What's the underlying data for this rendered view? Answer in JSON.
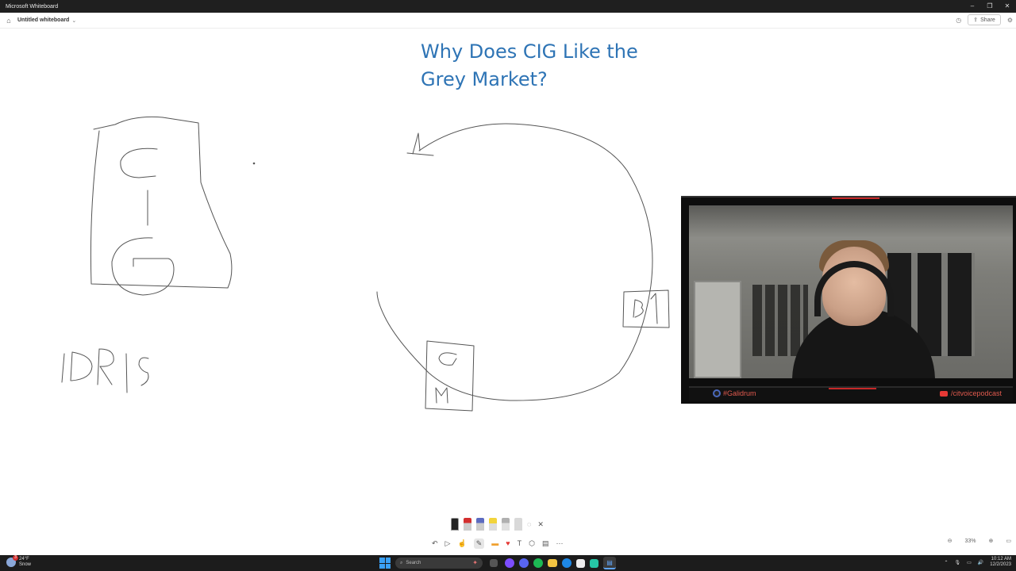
{
  "window": {
    "title": "Microsoft Whiteboard",
    "controls": [
      "–",
      "❐",
      "✕"
    ]
  },
  "appbar": {
    "doc_name": "Untitled whiteboard",
    "share_label": "Share"
  },
  "canvas": {
    "heading_line1": "Why Does CIG Like the",
    "heading_line2": "Grey Market?",
    "ink_text": {
      "cig_letters": "C I G",
      "idris": "IDRIS",
      "box_gm_top": "G",
      "box_gm_bottom": "M",
      "box_b1": "B 1",
      "arrow_tip": "A"
    }
  },
  "webcam": {
    "handle": "#Galidrum",
    "channel": "/citvoicepodcast",
    "accent_color": "#c62828"
  },
  "ink_toolbar": {
    "pens": [
      {
        "name": "black-pen",
        "color": "#222222"
      },
      {
        "name": "red-pen",
        "color": "#d32f2f"
      },
      {
        "name": "blue-pen",
        "color": "#5c6bc0"
      },
      {
        "name": "highlighter",
        "color": "#f2d43b"
      },
      {
        "name": "pencil",
        "color": "#b0b0b0"
      },
      {
        "name": "eraser",
        "color": "#d9d9d9"
      }
    ],
    "lasso_glyph": "◌",
    "close_glyph": "✕"
  },
  "main_toolbar": {
    "undo": "↶",
    "select": "▷",
    "touch": "☝",
    "pen": "✎",
    "note": "▬",
    "reaction": "♥",
    "text": "T",
    "shape": "⬡",
    "template": "▤",
    "more": "···"
  },
  "zoom": {
    "zoom_out": "⊖",
    "level": "33%",
    "zoom_in": "⊕",
    "fit": "▭"
  },
  "taskbar": {
    "weather_temp": "24°F",
    "weather_cond": "Snow",
    "weather_badge": "3",
    "search_placeholder": "Search",
    "time": "10:12 AM",
    "date": "12/2/2023"
  }
}
